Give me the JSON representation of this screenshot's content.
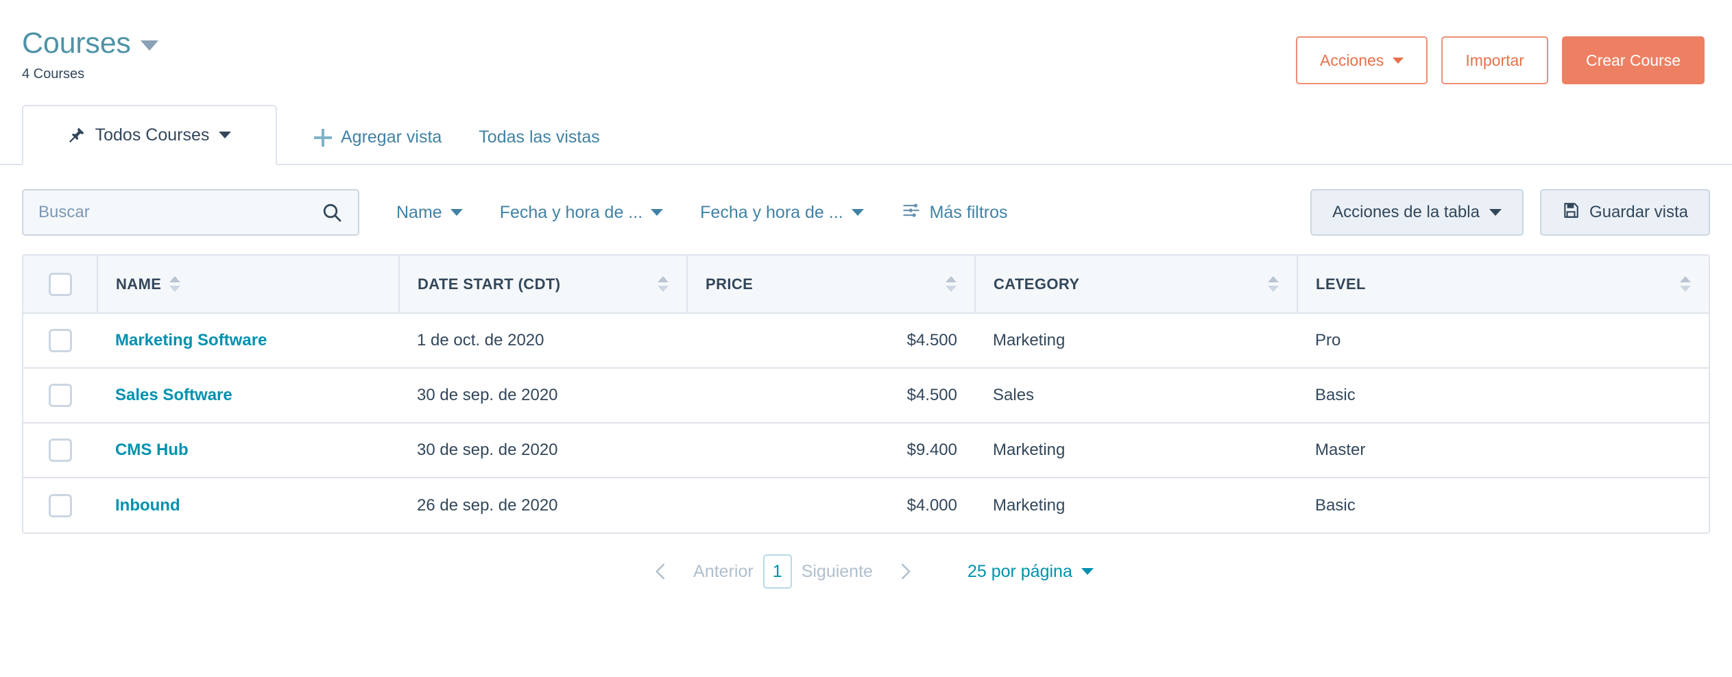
{
  "header": {
    "title": "Courses",
    "subtitle": "4 Courses",
    "title_caret_icon": "chevron-down-icon",
    "actions": {
      "acciones_label": "Acciones",
      "importar_label": "Importar",
      "crear_label": "Crear Course"
    }
  },
  "colors": {
    "brand_orange": "#ED8063",
    "orange_text": "#E8704A",
    "title_teal": "#4F93A8",
    "link_blue": "#4182A4",
    "link_teal": "#0091AE",
    "text_navy": "#33475B",
    "border_gray": "#DFE3EB",
    "header_bg": "#F5F8FA",
    "button_gray": "#EAF0F6"
  },
  "tabs": {
    "active": {
      "label": "Todos Courses",
      "pin_icon": "pin-icon",
      "caret_icon": "chevron-down-icon"
    },
    "add_view": {
      "label": "Agregar vista",
      "icon": "plus-icon"
    },
    "all_views": {
      "label": "Todas las vistas"
    }
  },
  "toolbar": {
    "search": {
      "placeholder": "Buscar",
      "value": "",
      "icon": "search-icon"
    },
    "filters": [
      {
        "label": "Name",
        "caret_icon": "chevron-down-icon"
      },
      {
        "label": "Fecha y hora de ...",
        "caret_icon": "chevron-down-icon"
      },
      {
        "label": "Fecha y hora de ...",
        "caret_icon": "chevron-down-icon"
      }
    ],
    "more_filters": {
      "label": "Más filtros",
      "icon": "sliders-icon"
    },
    "table_actions": {
      "label": "Acciones de la tabla",
      "caret_icon": "chevron-down-icon"
    },
    "save_view": {
      "label": "Guardar vista",
      "icon": "save-icon"
    }
  },
  "table": {
    "select_all_checkbox": false,
    "columns": [
      {
        "key": "name",
        "label": "NAME",
        "sortable": true
      },
      {
        "key": "date",
        "label": "DATE START (CDT)",
        "sortable": true
      },
      {
        "key": "price",
        "label": "PRICE",
        "sortable": true
      },
      {
        "key": "category",
        "label": "CATEGORY",
        "sortable": true
      },
      {
        "key": "level",
        "label": "LEVEL",
        "sortable": true
      }
    ],
    "rows": [
      {
        "checked": false,
        "name": "Marketing Software",
        "date": "1 de oct. de 2020",
        "price": "$4.500",
        "category": "Marketing",
        "level": "Pro"
      },
      {
        "checked": false,
        "name": "Sales Software",
        "date": "30 de sep. de 2020",
        "price": "$4.500",
        "category": "Sales",
        "level": "Basic"
      },
      {
        "checked": false,
        "name": "CMS Hub",
        "date": "30 de sep. de 2020",
        "price": "$9.400",
        "category": "Marketing",
        "level": "Master"
      },
      {
        "checked": false,
        "name": "Inbound",
        "date": "26 de sep. de 2020",
        "price": "$4.000",
        "category": "Marketing",
        "level": "Basic"
      }
    ]
  },
  "pagination": {
    "prev_label": "Anterior",
    "next_label": "Siguiente",
    "current_page": "1",
    "prev_icon": "chevron-left-icon",
    "next_icon": "chevron-right-icon",
    "per_page_label": "25 por página",
    "per_page_caret_icon": "chevron-down-icon"
  }
}
